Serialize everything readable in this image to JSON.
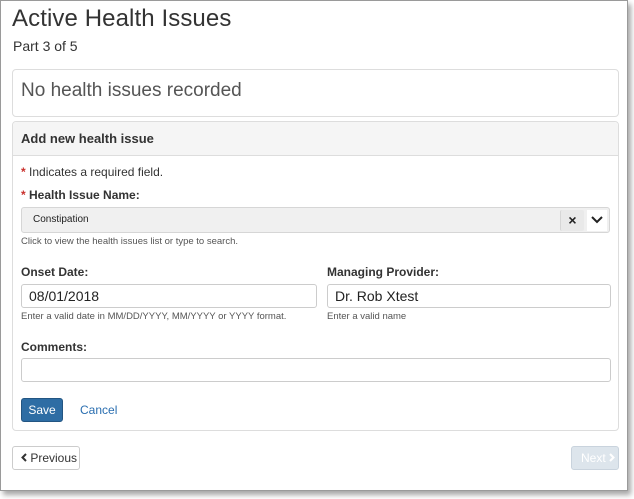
{
  "page": {
    "title": "Active Health Issues",
    "subtitle": "Part 3 of 5"
  },
  "empty_state": {
    "message": "No health issues recorded"
  },
  "form": {
    "heading": "Add new health issue",
    "required_note": {
      "star": "*",
      "text": "Indicates a required field."
    },
    "health_issue": {
      "star": "*",
      "label": "Health Issue Name:",
      "value": "Constipation",
      "clear_glyph": "×",
      "toggle_icon": "chevron-down-icon",
      "help": "Click to view the health issues list or type to search."
    },
    "onset_date": {
      "label": "Onset Date:",
      "value": "08/01/2018",
      "help": "Enter a valid date in MM/DD/YYYY, MM/YYYY or YYYY format."
    },
    "managing_provider": {
      "label": "Managing Provider:",
      "value": "Dr. Rob Xtest",
      "help": "Enter a valid name"
    },
    "comments": {
      "label": "Comments:",
      "value": ""
    },
    "save_label": "Save",
    "cancel_label": "Cancel"
  },
  "nav": {
    "previous_label": "Previous",
    "next_label": "Next",
    "previous_icon": "chevron-left-icon",
    "next_icon": "chevron-right-icon"
  },
  "colors": {
    "primary": "#2e6da4",
    "link": "#2a6eb0",
    "required": "#c9302c",
    "disabled_button": "#dde5ec"
  }
}
